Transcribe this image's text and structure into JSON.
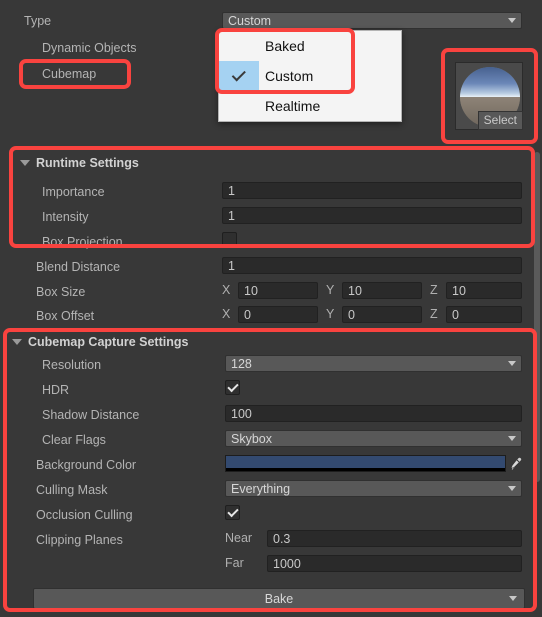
{
  "inspector": {
    "type_row": {
      "label": "Type",
      "value": "Custom"
    },
    "type_children": [
      {
        "label": "Dynamic Objects"
      },
      {
        "label": "Cubemap"
      }
    ],
    "dropdown": {
      "options": [
        {
          "label": "Baked",
          "selected": false
        },
        {
          "label": "Custom",
          "selected": true
        },
        {
          "label": "Realtime",
          "selected": false
        }
      ]
    },
    "cubemap_preview": {
      "select_label": "Select",
      "sky_color": "#6b87b8",
      "ground_color": "#7b7268"
    },
    "runtime_settings": {
      "title": "Runtime Settings",
      "rows": [
        {
          "label": "Importance",
          "kind": "text",
          "value": "1"
        },
        {
          "label": "Intensity",
          "kind": "text",
          "value": "1"
        },
        {
          "label": "Box Projection",
          "kind": "checkbox",
          "checked": false
        }
      ]
    },
    "transform_rows": {
      "blend_distance": {
        "label": "Blend Distance",
        "value": "1"
      },
      "box_size": {
        "label": "Box Size",
        "x_label": "X",
        "x": "10",
        "y_label": "Y",
        "y": "10",
        "z_label": "Z",
        "z": "10"
      },
      "box_offset": {
        "label": "Box Offset",
        "x_label": "X",
        "x": "0",
        "y_label": "Y",
        "y": "0",
        "z_label": "Z",
        "z": "0"
      }
    },
    "capture_settings": {
      "title": "Cubemap Capture Settings",
      "resolution": {
        "label": "Resolution",
        "value": "128"
      },
      "hdr": {
        "label": "HDR",
        "checked": true
      },
      "shadow_distance": {
        "label": "Shadow Distance",
        "value": "100"
      },
      "clear_flags": {
        "label": "Clear Flags",
        "value": "Skybox"
      },
      "background_color": {
        "label": "Background Color",
        "value": "#334a70"
      },
      "culling_mask": {
        "label": "Culling Mask",
        "value": "Everything"
      },
      "occlusion_culling": {
        "label": "Occlusion Culling",
        "checked": true
      },
      "clipping_planes": {
        "label": "Clipping Planes",
        "near_label": "Near",
        "near": "0.3",
        "far_label": "Far",
        "far": "1000"
      },
      "bake_button": {
        "label": "Bake"
      }
    },
    "accent_color": "#f9433f"
  }
}
